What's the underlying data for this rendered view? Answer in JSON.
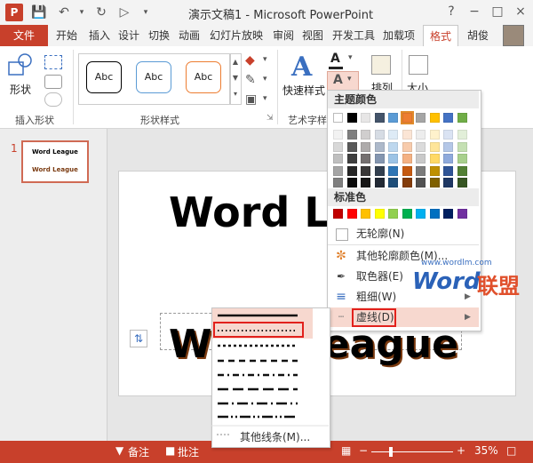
{
  "window": {
    "title": "演示文稿1 - Microsoft PowerPoint",
    "app_icon": "P",
    "qat_icons": [
      "save-icon",
      "undo-icon",
      "redo-icon",
      "slideshow-icon",
      "customize-icon"
    ],
    "controls": [
      "?",
      "−",
      "□",
      "×"
    ]
  },
  "tabs": {
    "file": "文件",
    "items": [
      "开始",
      "插入",
      "设计",
      "切换",
      "动画",
      "幻灯片放映",
      "审阅",
      "视图",
      "开发工具",
      "加载项"
    ],
    "active": "格式",
    "user": "胡俊"
  },
  "ribbon": {
    "shape_label": "形状",
    "insert_shapes_group": "插入形状",
    "style_samples": [
      "Abc",
      "Abc",
      "Abc"
    ],
    "shape_styles_group": "形状样式",
    "quick_styles": "快速样式",
    "art_group": "艺术字样式",
    "arrange": "排列",
    "size": "大小"
  },
  "slides": {
    "number": "1",
    "thumb_line1": "Word League",
    "thumb_line2": "Word League"
  },
  "canvas": {
    "text1": "Word League",
    "text2": "Word League"
  },
  "color_menu": {
    "theme_header": "主题颜色",
    "standard_header": "标准色",
    "theme_top": [
      "#ffffff",
      "#000000",
      "#e7e6e6",
      "#44546a",
      "#5b9bd5",
      "#ed7d31",
      "#a5a5a5",
      "#ffc000",
      "#4472c4",
      "#70ad47"
    ],
    "theme_shades": [
      [
        "#f2f2f2",
        "#7f7f7f",
        "#d0cece",
        "#d6dce4",
        "#deebf6",
        "#fbe5d5",
        "#ededed",
        "#fff2cc",
        "#dae3f3",
        "#e2efd9"
      ],
      [
        "#d8d8d8",
        "#595959",
        "#aeabab",
        "#adb9ca",
        "#bdd7ee",
        "#f7cbac",
        "#dbdbdb",
        "#fee599",
        "#b4c7e7",
        "#c5e0b3"
      ],
      [
        "#bfbfbf",
        "#3f3f3f",
        "#757070",
        "#8496b0",
        "#9cc3e5",
        "#f4b183",
        "#c9c9c9",
        "#ffd965",
        "#8faadc",
        "#a8d08d"
      ],
      [
        "#a5a5a5",
        "#262626",
        "#3a3838",
        "#323f4f",
        "#2e75b5",
        "#c55a11",
        "#7b7b7b",
        "#bf9000",
        "#2f5496",
        "#538135"
      ],
      [
        "#7f7f7f",
        "#0c0c0c",
        "#171616",
        "#222a35",
        "#1e4e79",
        "#833c0b",
        "#525252",
        "#7f6000",
        "#1f3864",
        "#375623"
      ]
    ],
    "standard": [
      "#c00000",
      "#ff0000",
      "#ffc000",
      "#ffff00",
      "#92d050",
      "#00b050",
      "#00b0f0",
      "#0070c0",
      "#002060",
      "#7030a0"
    ],
    "no_outline": "无轮廓(N)",
    "more_colors": "其他轮廓颜色(M)...",
    "eyedropper": "取色器(E)",
    "weight": "粗细(W)",
    "dashes": "虚线(D)"
  },
  "dash_menu": {
    "more_lines": "其他线条(M)...",
    "styles": [
      "solid",
      "round-dot",
      "square-dot",
      "dash",
      "dash-dot",
      "long-dash",
      "long-dash-dot",
      "long-dash-dot-dot"
    ]
  },
  "status": {
    "notes": "备注",
    "comments": "批注",
    "zoom": "35%"
  },
  "watermark": {
    "url": "www.wordlm.com",
    "word": "Word",
    "cn": "联盟"
  },
  "colors": {
    "accent": "#c8402b",
    "highlight": "#e2211c"
  }
}
